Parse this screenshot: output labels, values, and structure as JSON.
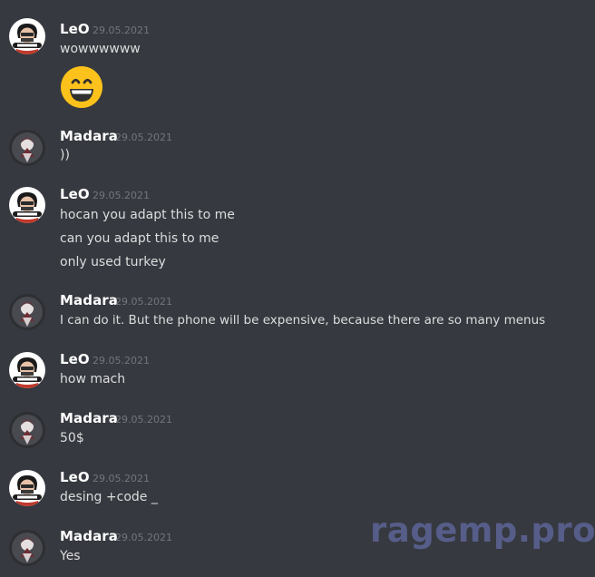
{
  "messages": [
    {
      "author": "LeO",
      "date": "29.05.2021",
      "lines": [
        "wowwwwww"
      ],
      "emoji": "grinning-face-emoji"
    },
    {
      "author": "Madara",
      "date": "29.05.2021",
      "lines": [
        "))"
      ]
    },
    {
      "author": "LeO",
      "date": "29.05.2021",
      "lines": [
        "hocan you adapt this to me",
        "can you adapt this to me",
        "only used turkey"
      ]
    },
    {
      "author": "Madara",
      "date": "29.05.2021",
      "lines": [
        "I can do it. But the phone will be expensive, because there are so many menus"
      ]
    },
    {
      "author": "LeO",
      "date": "29.05.2021",
      "lines": [
        "how mach"
      ]
    },
    {
      "author": "Madara",
      "date": "29.05.2021",
      "lines": [
        "50$"
      ]
    },
    {
      "author": "LeO",
      "date": "29.05.2021",
      "lines": [
        "desing +code _"
      ]
    },
    {
      "author": "Madara",
      "date": "29.05.2021",
      "lines": [
        "Yes"
      ]
    }
  ],
  "watermark": "ragemp.pro",
  "colors": {
    "background": "#36393f",
    "username": "#ffffff",
    "timestamp": "#72767d",
    "message_text": "#dcddde",
    "watermark": "#5d6496"
  }
}
